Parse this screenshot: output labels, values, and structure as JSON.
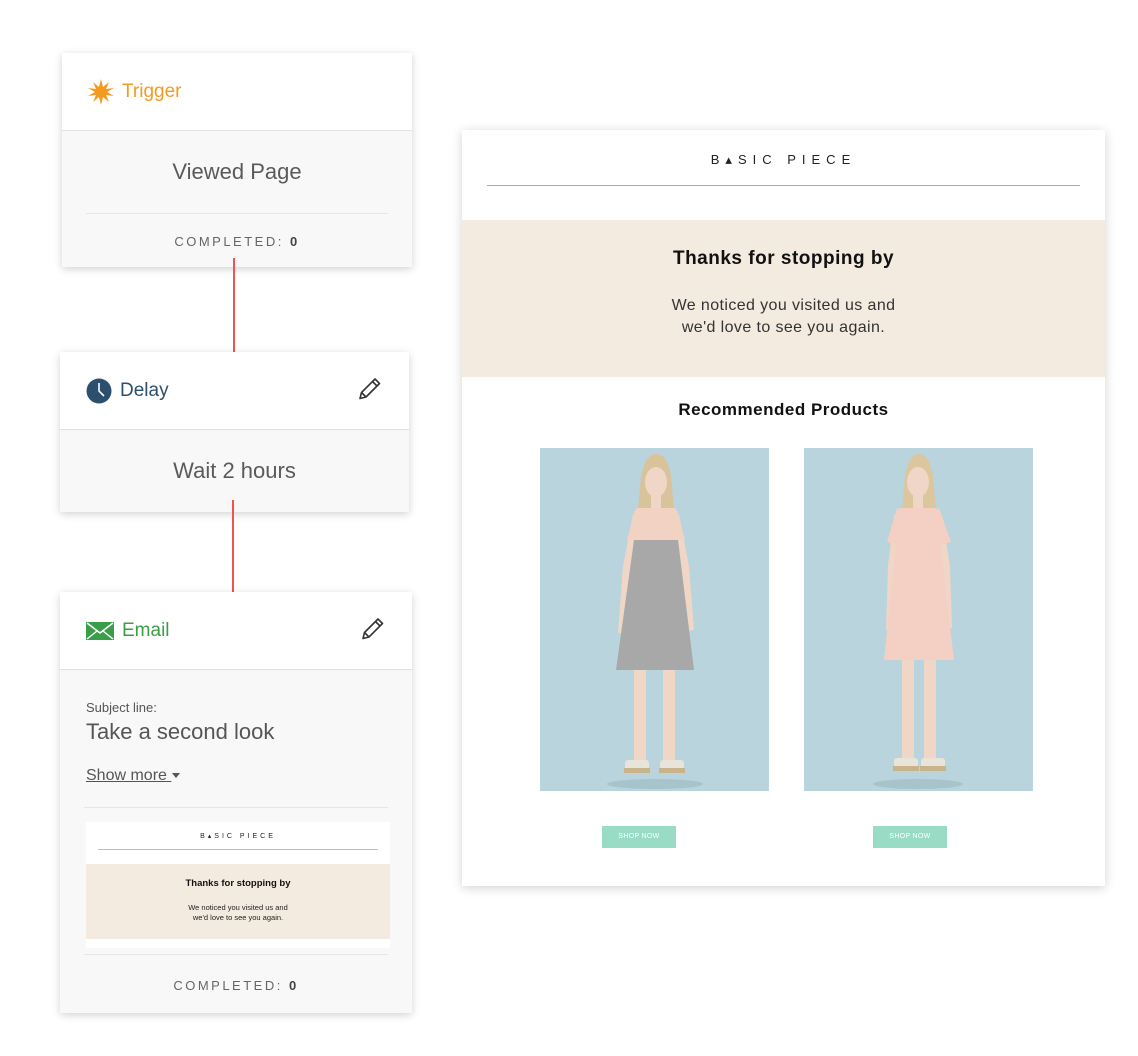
{
  "trigger": {
    "label": "Trigger",
    "event": "Viewed Page",
    "completed_label": "COMPLETED:",
    "completed_count": "0"
  },
  "delay": {
    "label": "Delay",
    "wait_text": "Wait 2 hours"
  },
  "email": {
    "label": "Email",
    "subject_caption": "Subject line:",
    "subject": "Take a second look",
    "show_more": "Show more",
    "completed_label": "COMPLETED:",
    "completed_count": "0",
    "thumbnail": {
      "brand": "B▴SIC PIECE",
      "headline": "Thanks for stopping by",
      "body_line1": "We noticed you visited us and",
      "body_line2": "we'd love to see you again."
    }
  },
  "preview": {
    "brand": "B▴SIC PIECE",
    "headline": "Thanks for stopping by",
    "body_line1": "We noticed you visited us and",
    "body_line2": "we'd love to see you again.",
    "recommended_title": "Recommended Products",
    "products": [
      {
        "dress": "grey dress with pink yoke",
        "button": "SHOP NOW"
      },
      {
        "dress": "pink dress",
        "button": "SHOP NOW"
      }
    ]
  },
  "colors": {
    "trigger_accent": "#f39a1f",
    "delay_accent": "#2c4f6e",
    "email_accent": "#3a9e49",
    "arrow": "#ee5454",
    "hero_bg": "#f3ebe0",
    "product_bg": "#b9d4dc",
    "shop_button": "#98dcc6"
  },
  "icons": {
    "trigger": "starburst-icon",
    "delay": "clock-icon",
    "email": "envelope-icon",
    "edit": "pencil-icon",
    "show_more": "caret-down-icon"
  }
}
